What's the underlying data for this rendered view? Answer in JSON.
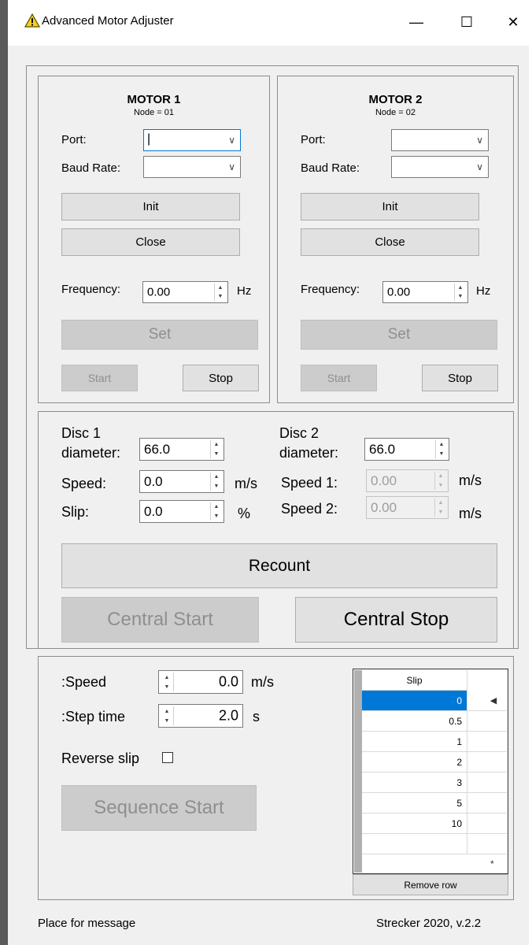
{
  "window": {
    "title": "Advanced Motor Adjuster",
    "controls": [
      "—",
      "☐",
      "✕"
    ]
  },
  "motor1": {
    "title": "MOTOR 1",
    "node": "Node = 01",
    "port_label": "Port:",
    "port_value": "|",
    "baud_label": "Baud Rate:",
    "baud_value": "",
    "init_label": "Init",
    "close_label": "Close",
    "freq_label": "Frequency:",
    "freq_value": "0.00",
    "freq_unit": "Hz",
    "set_label": "Set",
    "start_label": "Start",
    "stop_label": "Stop"
  },
  "motor2": {
    "title": "MOTOR 2",
    "node": "Node = 02",
    "port_label": "Port:",
    "port_value": "",
    "baud_label": "Baud Rate:",
    "baud_value": "",
    "init_label": "Init",
    "close_label": "Close",
    "freq_label": "Frequency:",
    "freq_value": "0.00",
    "freq_unit": "Hz",
    "set_label": "Set",
    "start_label": "Start",
    "stop_label": "Stop"
  },
  "central": {
    "disc1_line1": "Disc 1",
    "disc1_line2": "diameter:",
    "disc1_value": "66.0",
    "disc2_line1": "Disc 2",
    "disc2_line2": "diameter:",
    "disc2_value": "66.0",
    "speed_label": "Speed:",
    "speed_value": "0.0",
    "speed_unit": "m/s",
    "slip_label": "Slip:",
    "slip_value": "0.0",
    "slip_unit": "%",
    "speed1_label": "Speed 1:",
    "speed1_value": "0.00",
    "speed2_label": "Speed 2:",
    "speed2_value": "0.00",
    "speed12_unit": "m/s",
    "speed12_unit_b": "m/s",
    "recount_label": "Recount",
    "central_start_label": "Central Start",
    "central_stop_label": "Central Stop"
  },
  "sequence": {
    "speed_label": ":Speed",
    "speed_value": "0.0",
    "speed_unit": "m/s",
    "step_label": ":Step time",
    "step_value": "2.0",
    "step_unit": "s",
    "reverse_label": "Reverse slip",
    "start_label": "Sequence Start",
    "grid_header": "Slip",
    "grid_rows": [
      "0",
      "0.5",
      "1",
      "2",
      "3",
      "5",
      "10",
      ""
    ],
    "new_row_marker": "*",
    "current_row_marker": "◀",
    "remove_row_label": "Remove row"
  },
  "status": {
    "message": "Place for message",
    "version": "Strecker 2020, v.2.2"
  }
}
